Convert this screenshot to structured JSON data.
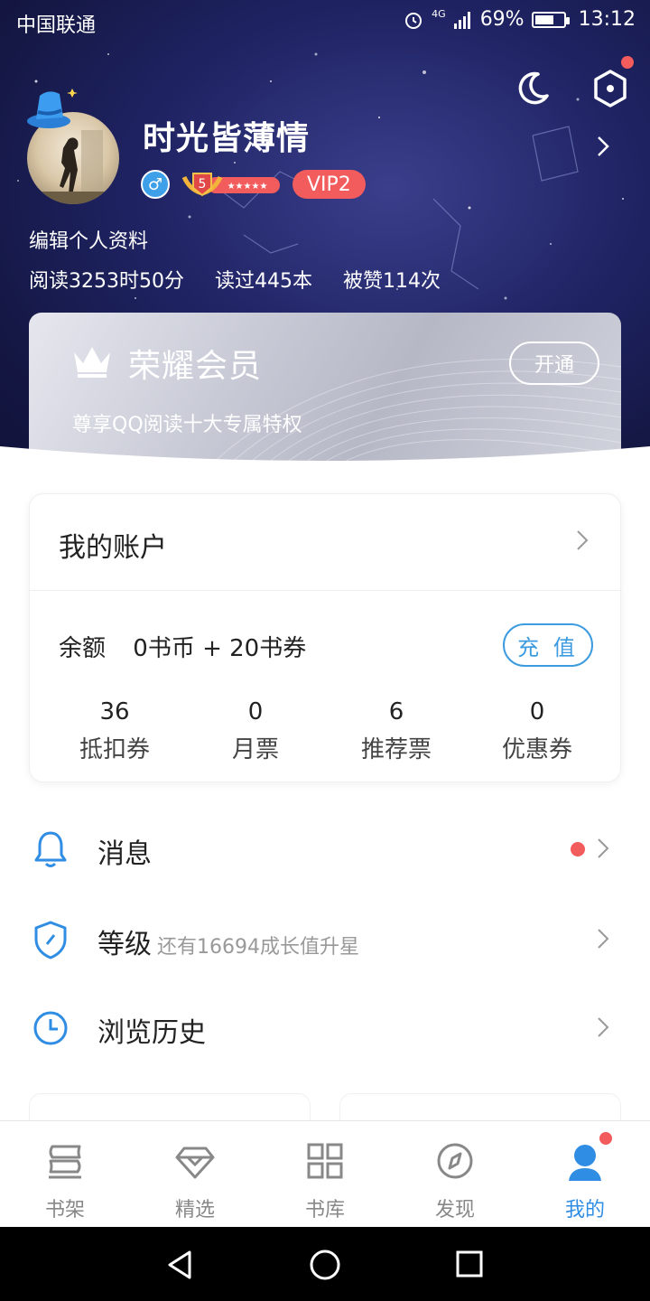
{
  "status_bar": {
    "carrier": "中国联通",
    "network": "4G",
    "battery": "69%",
    "battery_level": 0.69,
    "time": "13:12"
  },
  "profile": {
    "username": "时光皆薄情",
    "level": "5",
    "vip": "VIP2",
    "edit_label": "编辑个人资料",
    "stats": [
      "阅读3253时50分",
      "读过445本",
      "被赞114次"
    ]
  },
  "vip_card": {
    "title": "荣耀会员",
    "subtitle": "尊享QQ阅读十大专属特权",
    "button": "开通"
  },
  "account": {
    "title": "我的账户",
    "balance_label": "余额",
    "balance_value": "0书币 + 20书券",
    "recharge": "充 值",
    "counts": [
      {
        "num": "36",
        "label": "抵扣券"
      },
      {
        "num": "0",
        "label": "月票"
      },
      {
        "num": "6",
        "label": "推荐票"
      },
      {
        "num": "0",
        "label": "优惠券"
      }
    ]
  },
  "menu": {
    "messages": {
      "title": "消息",
      "icon": "bell-icon"
    },
    "level": {
      "title": "等级",
      "subtitle": "还有16694成长值升星",
      "icon": "shield-icon"
    },
    "history": {
      "title": "浏览历史",
      "icon": "clock-icon"
    }
  },
  "tabs": [
    {
      "label": "书架",
      "icon": "bookshelf-icon"
    },
    {
      "label": "精选",
      "icon": "diamond-icon"
    },
    {
      "label": "书库",
      "icon": "grid-icon"
    },
    {
      "label": "发现",
      "icon": "compass-icon"
    },
    {
      "label": "我的",
      "icon": "person-icon"
    }
  ],
  "colors": {
    "accent_blue": "#2f8de4",
    "badge_red": "#f25c5c",
    "header_dark": "#1f2363"
  }
}
